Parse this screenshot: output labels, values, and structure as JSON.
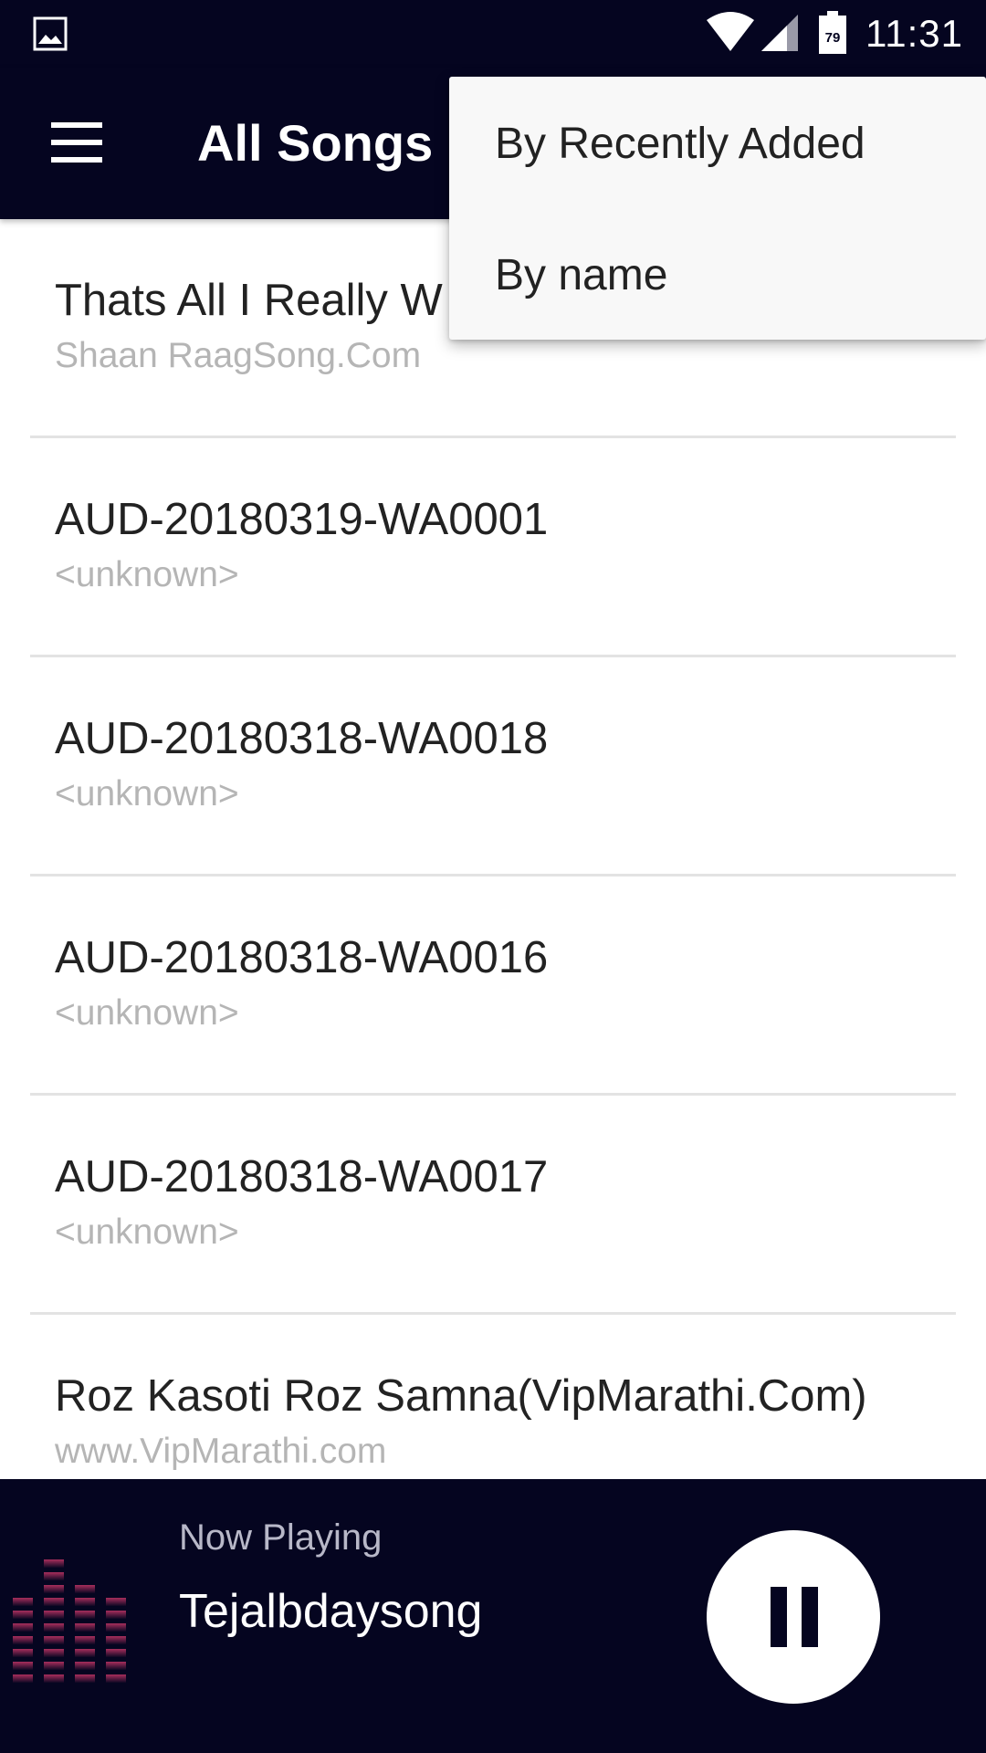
{
  "status_bar": {
    "time": "11:31",
    "battery_level": "79",
    "icons": [
      "gallery-icon",
      "wifi-icon",
      "signal-icon",
      "battery-icon"
    ]
  },
  "app_bar": {
    "title": "All Songs",
    "menu_icon": "menu-icon"
  },
  "sort_menu": {
    "options": [
      {
        "label": "By Recently Added"
      },
      {
        "label": "By name"
      }
    ]
  },
  "songs": [
    {
      "title": "Thats All I Really W",
      "artist": "Shaan RaagSong.Com"
    },
    {
      "title": "AUD-20180319-WA0001",
      "artist": "<unknown>"
    },
    {
      "title": "AUD-20180318-WA0018",
      "artist": "<unknown>"
    },
    {
      "title": "AUD-20180318-WA0016",
      "artist": "<unknown>"
    },
    {
      "title": "AUD-20180318-WA0017",
      "artist": "<unknown>"
    },
    {
      "title": "Roz Kasoti Roz Samna(VipMarathi.Com)",
      "artist": "www.VipMarathi.com"
    }
  ],
  "now_playing": {
    "label": "Now Playing",
    "title": "Tejalbdaysong",
    "state": "playing",
    "control_icon": "pause-icon"
  },
  "colors": {
    "app_bar_bg": "#050520",
    "accent": "#c2185b",
    "divider": "#e3e3e3"
  }
}
